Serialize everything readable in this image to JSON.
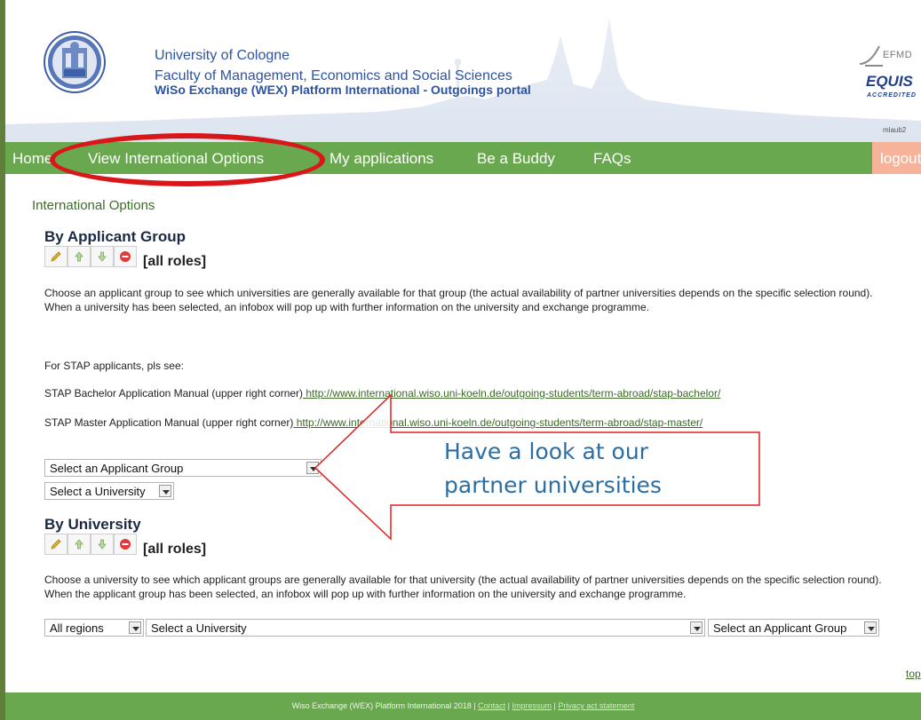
{
  "header": {
    "line1": "University of Cologne",
    "line2": "Faculty of Management, Economics and Social Sciences",
    "line3": "WiSo Exchange (WEX) Platform International - Outgoings portal",
    "efmd": "EFMD",
    "equis": "EQUIS",
    "accredited": "ACCREDITED",
    "user": "mlaub2"
  },
  "nav": {
    "home": "Home",
    "view_options": "View International Options",
    "my_applications": "My applications",
    "be_buddy": "Be a Buddy",
    "faqs": "FAQs",
    "logout": "logout"
  },
  "page": {
    "breadcrumb": "International Options",
    "section1": {
      "title": "By Applicant Group",
      "roles": "[all roles]",
      "description": "Choose an applicant group to see which universities are generally available for that group (the actual availability of partner universities depends on the specific selection round). When a university has been selected, an infobox will pop up with further information on the university and exchange programme.",
      "stap_intro": "For STAP applicants, pls see:",
      "stap_bachelor_label": "STAP Bachelor Application Manual (upper right corner)",
      "stap_bachelor_link": " http://www.international.wiso.uni-koeln.de/outgoing-students/term-abroad/stap-bachelor/",
      "stap_master_label": "STAP Master Application Manual (upper right corner)",
      "stap_master_link": " http://www.international.wiso.uni-koeln.de/outgoing-students/term-abroad/stap-master/",
      "select_group": "Select an Applicant Group",
      "select_university": "Select a University"
    },
    "section2": {
      "title": "By University",
      "roles": "[all roles]",
      "description": "Choose a university to see which applicant groups are generally available for that university (the actual availability of partner universities depends on the specific selection round). When the applicant group has been selected, an infobox will pop up with further information on the university and exchange programme.",
      "select_region": "All regions",
      "select_university": "Select a University",
      "select_group": "Select an Applicant Group"
    },
    "top_link": "top"
  },
  "callout": {
    "line1": "Have a look at our",
    "line2": "partner universities",
    "color": "#e02020"
  },
  "footer": {
    "text": "Wiso Exchange (WEX) Platform International 2018 | ",
    "contact": "Contact",
    "impressum": "Impressum",
    "privacy": "Privacy act statement",
    "sep": " | "
  },
  "colors": {
    "nav_green": "#6aa84f",
    "logout_salmon": "#f7b39a",
    "brand_blue": "#2c54a2",
    "annotation_red": "#d9161a"
  },
  "icons": [
    "edit-pencil-icon",
    "move-up-icon",
    "move-down-icon",
    "delete-icon",
    "dropdown-arrow-icon"
  ]
}
